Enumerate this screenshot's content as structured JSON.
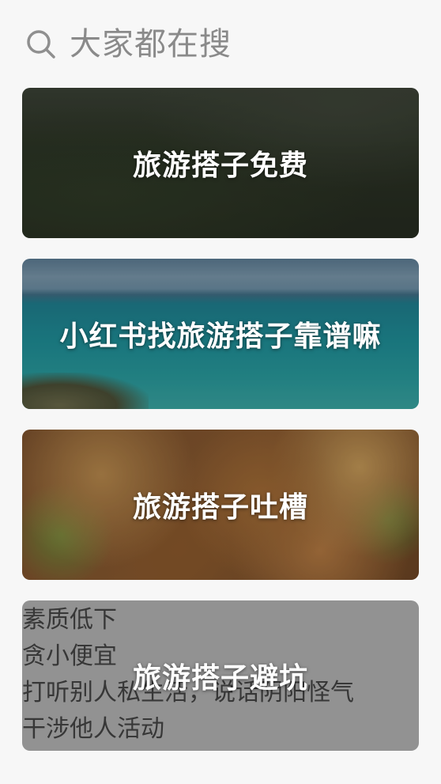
{
  "header": {
    "title": "大家都在搜",
    "icon": "search-icon"
  },
  "cards": [
    {
      "label": "旅游搭子免费"
    },
    {
      "label": "小红书找旅游搭子靠谱嘛"
    },
    {
      "label": "旅游搭子吐槽"
    },
    {
      "label": "旅游搭子避坑",
      "background_lines": [
        "素质低下",
        "贪小便宜",
        "打听别人私生活，说话阴阳怪气",
        "干涉他人活动"
      ]
    }
  ]
}
